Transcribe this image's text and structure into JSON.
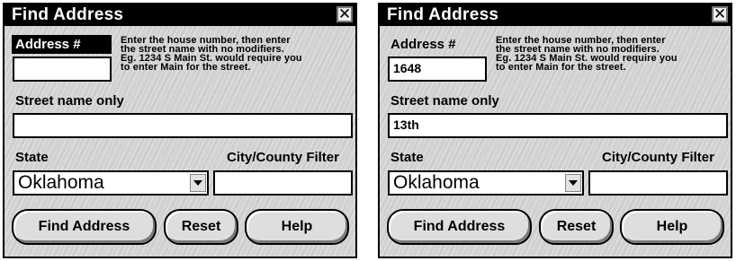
{
  "panels": [
    {
      "title": "Find Address",
      "close_glyph": "✕",
      "address_label": "Address #",
      "address_value": "",
      "instructions": "Enter the house number, then enter\nthe street name with no modifiers.\nEg. 1234 S Main St. would require you\nto enter Main for the street.",
      "street_label": "Street name only",
      "street_value": "",
      "state_label": "State",
      "state_value": "Oklahoma",
      "city_label": "City/County Filter",
      "city_value": "",
      "buttons": {
        "find": "Find Address",
        "reset": "Reset",
        "help": "Help"
      }
    },
    {
      "title": "Find Address",
      "close_glyph": "✕",
      "address_label": "Address #",
      "address_value": "1648",
      "instructions": "Enter the house number, then enter\nthe street name with no modifiers.\nEg. 1234 S Main St. would require you\nto enter Main for the street.",
      "street_label": "Street name only",
      "street_value": "13th",
      "state_label": "State",
      "state_value": "Oklahoma",
      "city_label": "City/County Filter",
      "city_value": "",
      "buttons": {
        "find": "Find Address",
        "reset": "Reset",
        "help": "Help"
      }
    }
  ],
  "colors": {
    "titlebar": "#000000",
    "panel_background": "#d2d2d2",
    "field_background": "#ffffff",
    "focus_label": "#000000"
  },
  "icons": {
    "close": "close-icon",
    "dropdown": "chevron-down-icon"
  }
}
